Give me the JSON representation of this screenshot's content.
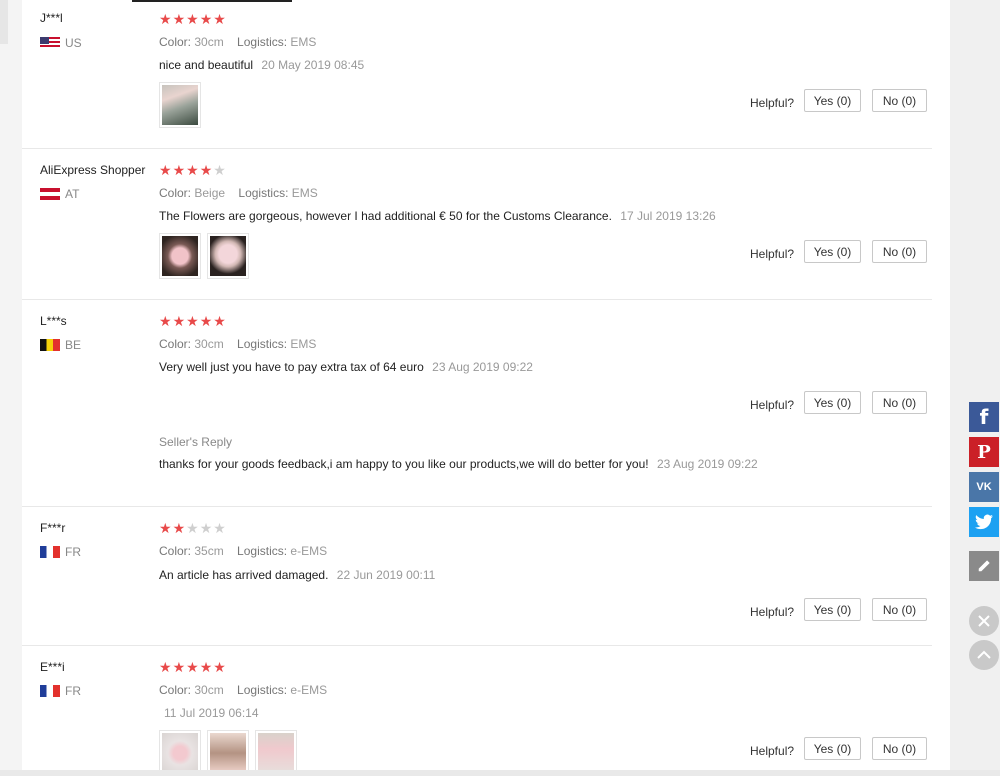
{
  "reviews": [
    {
      "user": "J***l",
      "country": "US",
      "stars": 5,
      "color_label": "Color:",
      "color_value": "30cm",
      "logistics_label": "Logistics:",
      "logistics_value": "EMS",
      "text": "nice and beautiful",
      "date": "20 May 2019 08:45",
      "helpful_label": "Helpful?",
      "yes_label": "Yes (0)",
      "no_label": "No (0)"
    },
    {
      "user": "AliExpress Shopper",
      "country": "AT",
      "stars": 4,
      "color_label": "Color:",
      "color_value": "Beige",
      "logistics_label": "Logistics:",
      "logistics_value": "EMS",
      "text": "The Flowers are gorgeous, however I had additional € 50 for the Customs Clearance.",
      "date": "17 Jul 2019 13:26",
      "helpful_label": "Helpful?",
      "yes_label": "Yes (0)",
      "no_label": "No (0)"
    },
    {
      "user": "L***s",
      "country": "BE",
      "stars": 5,
      "color_label": "Color:",
      "color_value": "30cm",
      "logistics_label": "Logistics:",
      "logistics_value": "EMS",
      "text": "Very well just you have to pay extra tax of 64 euro",
      "date": "23 Aug 2019 09:22",
      "helpful_label": "Helpful?",
      "yes_label": "Yes (0)",
      "no_label": "No (0)",
      "seller_reply_title": "Seller's Reply",
      "seller_reply_text": "thanks for your goods feedback,i am happy to you like our products,we will do better for you!",
      "seller_reply_date": "23 Aug 2019 09:22"
    },
    {
      "user": "F***r",
      "country": "FR",
      "stars": 2,
      "color_label": "Color:",
      "color_value": "35cm",
      "logistics_label": "Logistics:",
      "logistics_value": "e-EMS",
      "text": "An article has arrived damaged.",
      "date": "22 Jun 2019 00:11",
      "helpful_label": "Helpful?",
      "yes_label": "Yes (0)",
      "no_label": "No (0)"
    },
    {
      "user": "E***i",
      "country": "FR",
      "stars": 5,
      "color_label": "Color:",
      "color_value": "30cm",
      "logistics_label": "Logistics:",
      "logistics_value": "e-EMS",
      "text": "",
      "date": "11 Jul 2019 06:14",
      "helpful_label": "Helpful?",
      "yes_label": "Yes (0)",
      "no_label": "No (0)"
    }
  ],
  "share_bar": {
    "icons": [
      "facebook-icon",
      "pinterest-icon",
      "vk-icon",
      "twitter-icon",
      "edit-icon",
      "close-icon",
      "scroll-top-icon"
    ],
    "colors": {
      "facebook": "#3b5998",
      "pinterest": "#cb2027",
      "vk": "#4a76a8",
      "twitter": "#1da1f2"
    }
  },
  "colors": {
    "star_on": "#e84a4a",
    "star_off": "#cfcfcf"
  }
}
